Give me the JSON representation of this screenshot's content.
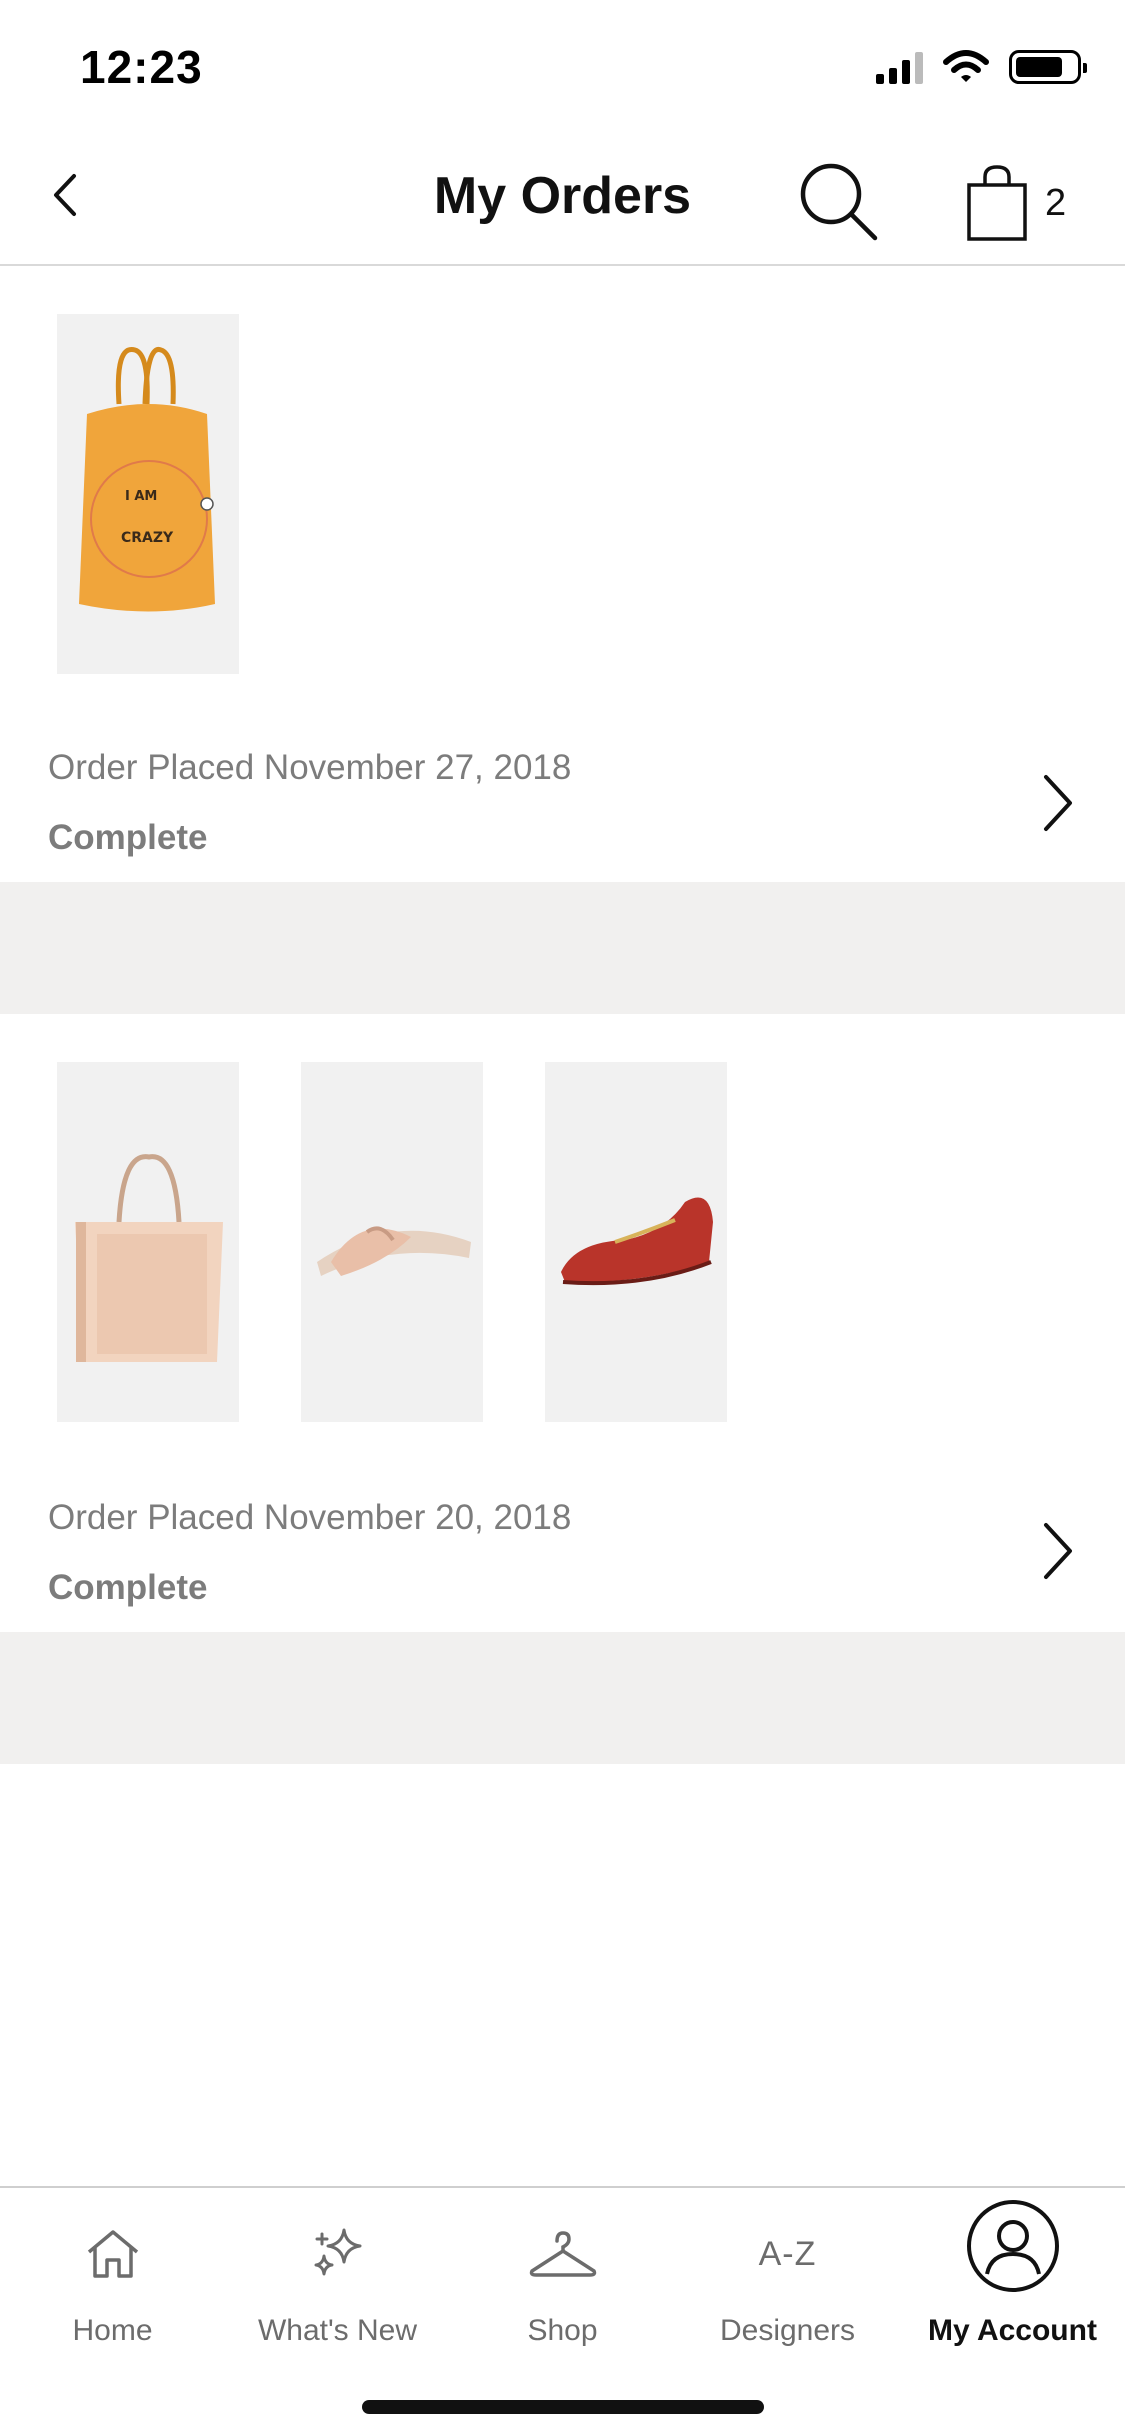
{
  "status_bar": {
    "time": "12:23"
  },
  "header": {
    "title": "My Orders",
    "bag_count": "2"
  },
  "orders": [
    {
      "date_text": "Order Placed November 27, 2018",
      "status": "Complete",
      "items": [
        "orange tote bag"
      ]
    },
    {
      "date_text": "Order Placed November 20, 2018",
      "status": "Complete",
      "items": [
        "beige leather tote",
        "blush knot slide sandal",
        "red leather loafer"
      ]
    }
  ],
  "tabbar": {
    "items": [
      {
        "label": "Home",
        "icon": "home-icon"
      },
      {
        "label": "What's New",
        "icon": "sparkle-icon"
      },
      {
        "label": "Shop",
        "icon": "hanger-icon"
      },
      {
        "label": "Designers",
        "icon": "a-z-icon",
        "glyph": "A-Z"
      },
      {
        "label": "My Account",
        "icon": "account-icon",
        "active": true
      }
    ]
  }
}
